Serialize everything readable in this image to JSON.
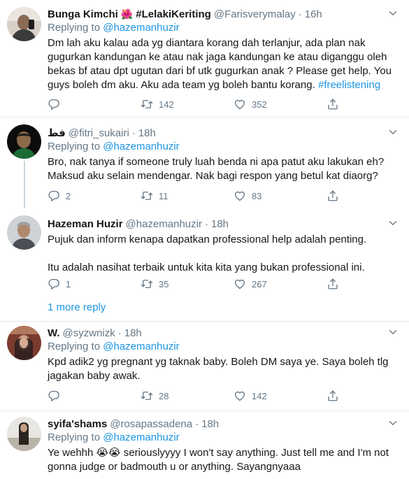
{
  "colors": {
    "accent": "#1b95e0",
    "muted": "#657786",
    "text": "#14171a",
    "divider": "#e6ecf0"
  },
  "tweets": [
    {
      "name": "Bunga Kimchi",
      "name_emoji": "🌺",
      "name_suffix": "#LelakiKeriting",
      "handle": "@Farisverymalay",
      "dot": "·",
      "time": "16h",
      "replying_prefix": "Replying to",
      "replying_to": "@hazemanhuzir",
      "text": "Dm lah aku kalau ada yg diantara korang dah terlanjur, ada plan nak gugurkan kandungan ke atau nak jaga kandungan ke atau diganggu oleh bekas bf atau dpt ugutan dari bf utk gugurkan anak ? Please get help. You guys boleh dm aku. Aku ada team yg boleh bantu korang.",
      "hashtag": "#freelistening",
      "replies": "",
      "retweets": "142",
      "likes": "352"
    },
    {
      "name": "",
      "name_prefix": "فط",
      "handle": "@fitri_sukairi",
      "dot": "·",
      "time": "18h",
      "replying_prefix": "Replying to",
      "replying_to": "@hazemanhuzir",
      "text": "Bro, nak tanya if someone truly luah benda ni apa patut aku lakukan eh? Maksud aku selain mendengar. Nak bagi respon yang betul kat diaorg?",
      "replies": "2",
      "retweets": "11",
      "likes": "83"
    },
    {
      "name": "Hazeman Huzir",
      "handle": "@hazemanhuzir",
      "dot": "·",
      "time": "18h",
      "text_1": "Pujuk dan inform kenapa dapatkan professional help adalah penting.",
      "text_2": "Itu adalah nasihat terbaik untuk kita kita yang bukan professional ini.",
      "replies": "1",
      "retweets": "35",
      "likes": "267",
      "more_replies": "1 more reply"
    },
    {
      "name": "W.",
      "handle": "@syzwnizk",
      "dot": "·",
      "time": "18h",
      "replying_prefix": "Replying to",
      "replying_to": "@hazemanhuzir",
      "text": "Kpd adik2 yg pregnant yg taknak baby. Boleh DM saya ye. Saya boleh tlg jagakan baby awak.",
      "replies": "",
      "retweets": "28",
      "likes": "142"
    },
    {
      "name": "syifa'shams",
      "handle": "@rosapassadena",
      "dot": "·",
      "time": "18h",
      "replying_prefix": "Replying to",
      "replying_to": "@hazemanhuzir",
      "text_a": "Ye wehhh",
      "text_emoji": "😭😭",
      "text_b": " seriouslyyyy I won't say anything. Just tell me and I'm not gonna judge or badmouth u or anything. Sayangnyaaa"
    }
  ],
  "icons": [
    "reply-icon",
    "retweet-icon",
    "like-icon",
    "share-icon",
    "caret-down-icon"
  ]
}
